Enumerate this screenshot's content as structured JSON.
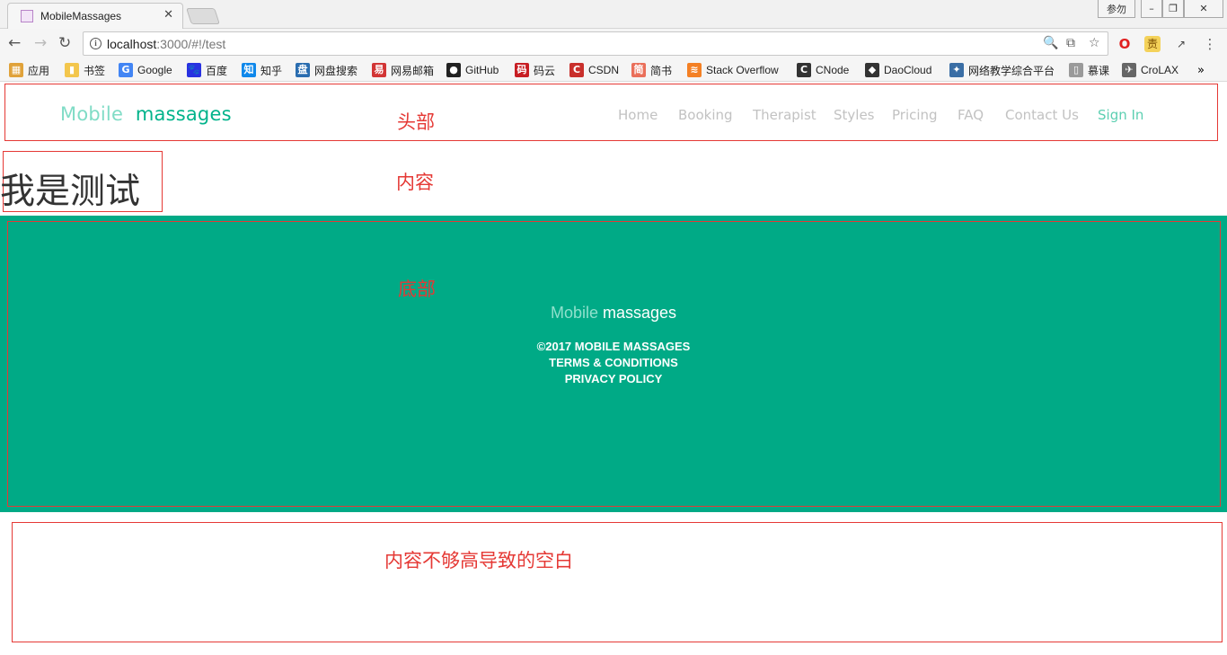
{
  "browser": {
    "tab": {
      "title": "MobileMassages",
      "close": "✕"
    },
    "window_controls": {
      "user": "参勿",
      "minimize": "–",
      "maximize": "❐",
      "close": "✕"
    },
    "nav": {
      "back": "←",
      "forward": "→",
      "reload": "↻"
    },
    "url": {
      "host": "localhost",
      "rest": ":3000/#!/test"
    },
    "omnibox_icons": {
      "zoom": "🔍",
      "translate": "⧉",
      "star": "☆"
    },
    "extensions": [
      "opera-icon",
      "extension-yellow-icon",
      "extension-gray-icon",
      "menu-icon"
    ],
    "bookmarks": [
      {
        "label": "应用",
        "icon": "apps-grid-icon",
        "color": "#e0a23a"
      },
      {
        "label": "书签",
        "icon": "folder-icon",
        "color": "#f3c64c"
      },
      {
        "label": "Google",
        "icon": "google-icon",
        "color": "#4285f4"
      },
      {
        "label": "百度",
        "icon": "baidu-icon",
        "color": "#2932e1"
      },
      {
        "label": "知乎",
        "icon": "zhihu-icon",
        "color": "#0f88eb"
      },
      {
        "label": "网盘搜索",
        "icon": "pan-icon",
        "color": "#2a6db0"
      },
      {
        "label": "网易邮箱",
        "icon": "netease-icon",
        "color": "#d23535"
      },
      {
        "label": "GitHub",
        "icon": "github-icon",
        "color": "#222222"
      },
      {
        "label": "码云",
        "icon": "gitee-icon",
        "color": "#c71d23"
      },
      {
        "label": "CSDN",
        "icon": "csdn-icon",
        "color": "#c9302c"
      },
      {
        "label": "简书",
        "icon": "jianshu-icon",
        "color": "#ea6f5a"
      },
      {
        "label": "Stack Overflow",
        "icon": "stackoverflow-icon",
        "color": "#f48024"
      },
      {
        "label": "CNode",
        "icon": "cnode-icon",
        "color": "#333333"
      },
      {
        "label": "DaoCloud",
        "icon": "daocloud-icon",
        "color": "#333333"
      },
      {
        "label": "网络教学综合平台",
        "icon": "platform-icon",
        "color": "#3a6ea5"
      },
      {
        "label": "慕课",
        "icon": "page-icon",
        "color": "#9a9a9a"
      },
      {
        "label": "CroLAX",
        "icon": "rocket-icon",
        "color": "#666666"
      }
    ],
    "bookmarks_more": "»"
  },
  "header": {
    "logo_light": "Mobile",
    "logo_bold": "massages",
    "nav": [
      "Home",
      "Booking",
      "Therapist",
      "Styles",
      "Pricing",
      "FAQ",
      "Contact Us",
      "Sign In"
    ]
  },
  "content": {
    "heading": "我是测试"
  },
  "footer": {
    "logo_light": "Mobile",
    "logo_bold": "massages",
    "copyright": "©2017 MOBILE MASSAGES",
    "terms": "TERMS & CONDITIONS",
    "privacy": "PRIVACY POLICY"
  },
  "annotations": {
    "header": "头部",
    "content": "内容",
    "footer": "底部",
    "gap": "内容不够高导致的空白",
    "color": "#e53935"
  },
  "colors": {
    "footer_bg": "#00aa86",
    "logo_light": "#80dcc6",
    "logo_bold": "#00b38b",
    "nav_text": "#c2c2c2",
    "sign_in": "#5ccfb1"
  }
}
